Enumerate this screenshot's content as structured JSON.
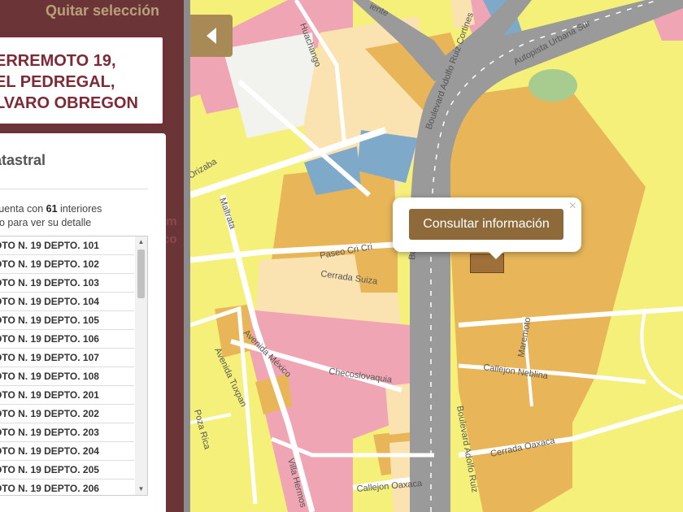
{
  "panel": {
    "clear_selection": "Quitar selección",
    "background_text": "im\nco",
    "title_lines": [
      "ERREMOTO 19,",
      "EL PEDREGAL,",
      "LVARO OBREGON"
    ],
    "section_heading": "atastral",
    "description_prefix": "cuenta con ",
    "interior_count": "61",
    "description_suffix": " interiores",
    "description_line2": "no para ver su detalle",
    "units": [
      "OTO N. 19 DEPTO. 101",
      "OTO N. 19 DEPTO. 102",
      "OTO N. 19 DEPTO. 103",
      "OTO N. 19 DEPTO. 104",
      "OTO N. 19 DEPTO. 105",
      "OTO N. 19 DEPTO. 106",
      "OTO N. 19 DEPTO. 107",
      "OTO N. 19 DEPTO. 108",
      "OTO N. 19 DEPTO. 201",
      "OTO N. 19 DEPTO. 202",
      "OTO N. 19 DEPTO. 203",
      "OTO N. 19 DEPTO. 204",
      "OTO N. 19 DEPTO. 205",
      "OTO N. 19 DEPTO. 206"
    ],
    "scroll_up_glyph": "▲",
    "scroll_down_glyph": "▼"
  },
  "map": {
    "popup": {
      "button_label": "Consultar información",
      "close_glyph": "×"
    },
    "streets": {
      "huachango": "Huachango",
      "orizaba": "Orizaba",
      "maltrata": "Maltrata",
      "paseo": "Paseo Cri Cri",
      "cerrada_suiza": "Cerrada Suiza",
      "avenida_tuxpan": "Avenida Tuxpan",
      "avenida_mexico": "Avenida México",
      "checoslovaquia": "Checoslovaquia",
      "callejon_neblina": "Callejon Neblina",
      "maremoto": "Maremoto",
      "poza_rica": "Poza Rica",
      "villa_hermosa": "Villa Hermos",
      "callejon_oaxaca": "Callejon Oaxaca",
      "cerrada_oaxaca": "Cerrada Oaxaca",
      "blvd_cortines_north": "Boulevard Adolfo Ruiz Cortines",
      "blvd_cortines_main": "Boulevard Adolfo Ruiz",
      "blvd_cortines_south": "Boulevard Adolfo Ruiz",
      "blvd_cortines_center": "Bo",
      "autopista": "Autopista Urbana Sur",
      "avendida": "Avendida",
      "iente": "iente"
    },
    "colors": {
      "residential": "#f5f07a",
      "commercial": "#e8b659",
      "mixed": "#fbe3b1",
      "housing": "#f0a5b4",
      "equipment": "#7fa9c9",
      "green": "#a8cc90",
      "road": "#9a9a9a",
      "street": "#ffffff"
    }
  }
}
